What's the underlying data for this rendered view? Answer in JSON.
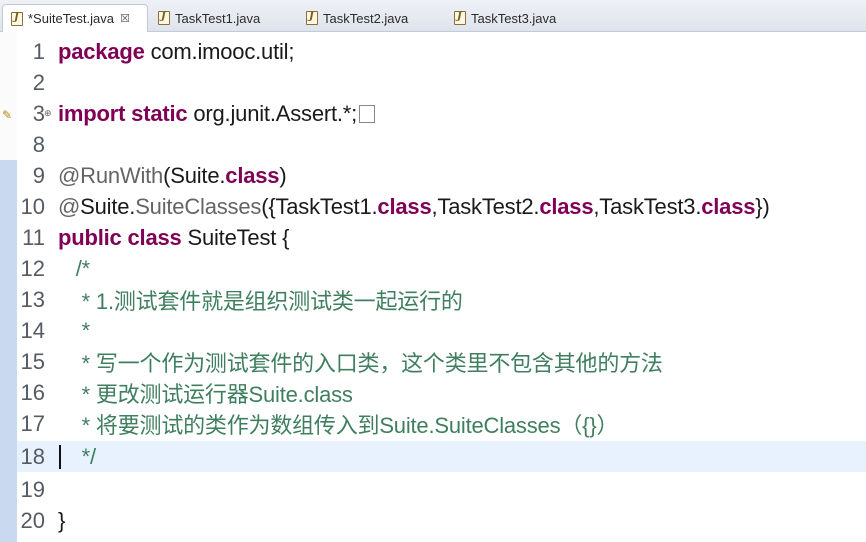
{
  "tabs": [
    {
      "label": "*SuiteTest.java",
      "active": true,
      "close": "☒"
    },
    {
      "label": "TaskTest1.java"
    },
    {
      "label": "TaskTest2.java"
    },
    {
      "label": "TaskTest3.java"
    }
  ],
  "editor": {
    "lines": {
      "l1": {
        "num": "1",
        "kw": "package",
        "rest": " com.imooc.util;"
      },
      "l2": {
        "num": "2"
      },
      "l3": {
        "num": "3",
        "kw1": "import",
        "kw2": "static",
        "rest": " org.junit.Assert.*;"
      },
      "l8": {
        "num": "8"
      },
      "l9": {
        "num": "9",
        "ann": "@RunWith",
        "p1": "(Suite.",
        "kw": "class",
        "p2": ")"
      },
      "l10": {
        "num": "10",
        "ann1": "@",
        "t1": "Suite.",
        "ann2": "SuiteClasses",
        "t2": "({TaskTest1.",
        "kw1": "class",
        "t3": ",TaskTest2.",
        "kw2": "class",
        "t4": ",TaskTest3.",
        "kw3": "class",
        "t5": "})"
      },
      "l11": {
        "num": "11",
        "kw1": "public",
        "kw2": "class",
        "rest": " SuiteTest {"
      },
      "l12": {
        "num": "12",
        "cm": "   /*"
      },
      "l13": {
        "num": "13",
        "cm": "    * 1.测试套件就是组织测试类一起运行的"
      },
      "l14": {
        "num": "14",
        "cm": "    *"
      },
      "l15": {
        "num": "15",
        "cm": "    * 写一个作为测试套件的入口类，这个类里不包含其他的方法"
      },
      "l16": {
        "num": "16",
        "cm": "    * 更改测试运行器Suite.class"
      },
      "l17": {
        "num": "17",
        "cm": "    * 将要测试的类作为数组传入到Suite.SuiteClasses（{}）"
      },
      "l18": {
        "num": "18",
        "cm": "    */"
      },
      "l19": {
        "num": "19"
      },
      "l20": {
        "num": "20",
        "rest": "}"
      }
    }
  },
  "colors": {
    "keyword": "#7f0055",
    "comment": "#3f7f5f",
    "annotation": "#646464",
    "current_line": "#e8f2fe"
  }
}
